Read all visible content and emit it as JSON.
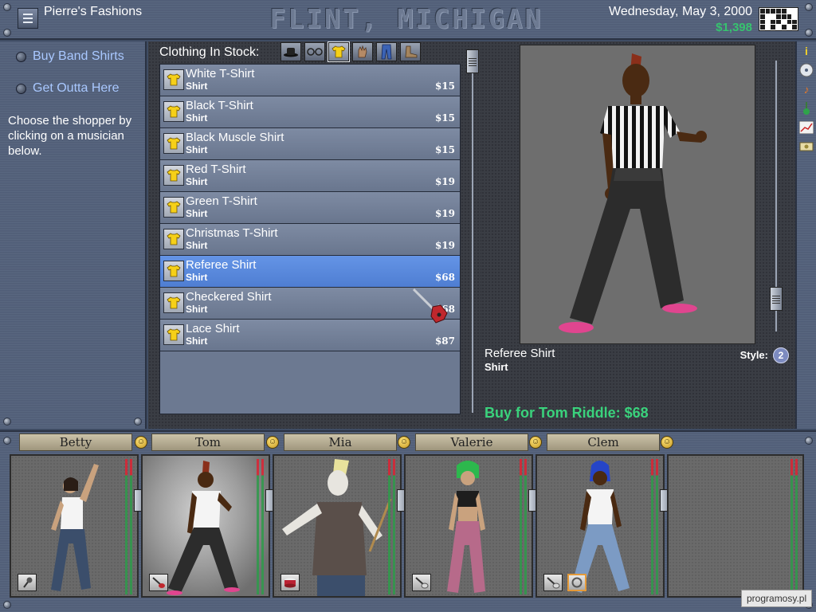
{
  "header": {
    "store_name": "Pierre's Fashions",
    "city_title": "FLINT, MICHIGAN",
    "date": "Wednesday, May 3, 2000",
    "money": "$1,398"
  },
  "left_panel": {
    "options": [
      {
        "label": "Buy Band Shirts"
      },
      {
        "label": "Get Outta Here"
      }
    ],
    "instruction": "Choose the shopper by clicking on a musician below."
  },
  "stock": {
    "label": "Clothing In Stock:",
    "categories": [
      {
        "icon": "hat-icon",
        "active": false
      },
      {
        "icon": "glasses-icon",
        "active": false
      },
      {
        "icon": "shirt-icon",
        "active": true
      },
      {
        "icon": "gloves-icon",
        "active": false
      },
      {
        "icon": "pants-icon",
        "active": false
      },
      {
        "icon": "boots-icon",
        "active": false
      }
    ],
    "items": [
      {
        "name": "White T-Shirt",
        "type": "Shirt",
        "price": "$15"
      },
      {
        "name": "Black T-Shirt",
        "type": "Shirt",
        "price": "$15"
      },
      {
        "name": "Black Muscle Shirt",
        "type": "Shirt",
        "price": "$15"
      },
      {
        "name": "Red T-Shirt",
        "type": "Shirt",
        "price": "$19"
      },
      {
        "name": "Green T-Shirt",
        "type": "Shirt",
        "price": "$19"
      },
      {
        "name": "Christmas T-Shirt",
        "type": "Shirt",
        "price": "$19"
      },
      {
        "name": "Referee Shirt",
        "type": "Shirt",
        "price": "$68",
        "selected": true
      },
      {
        "name": "Checkered Shirt",
        "type": "Shirt",
        "price": "$68"
      },
      {
        "name": "Lace Shirt",
        "type": "Shirt",
        "price": "$87"
      }
    ]
  },
  "preview": {
    "item_name": "Referee Shirt",
    "item_type": "Shirt",
    "style_label": "Style:",
    "style_number": "2",
    "buy_label": "Buy for Tom Riddle: $68"
  },
  "toolbar": {
    "buttons": [
      {
        "icon": "info-icon"
      },
      {
        "icon": "cd-icon"
      },
      {
        "icon": "music-note-icon"
      },
      {
        "icon": "guitar-icon"
      },
      {
        "icon": "chart-icon"
      },
      {
        "icon": "money-icon"
      }
    ]
  },
  "band": {
    "members": [
      {
        "name": "Betty",
        "instrument": "microphone-icon"
      },
      {
        "name": "Tom",
        "instrument": "guitar-icon",
        "selected": true
      },
      {
        "name": "Mia",
        "instrument": "drum-icon"
      },
      {
        "name": "Valerie",
        "instrument": "guitar-icon"
      },
      {
        "name": "Clem",
        "instrument": "guitar-icon",
        "extra_icon": "ring-icon"
      }
    ]
  },
  "watermark": "programosy.pl",
  "colors": {
    "money": "#37c36f",
    "buy_label": "#3ad27c",
    "selected_row": "#5a8be0",
    "link": "#a9c8ff"
  }
}
